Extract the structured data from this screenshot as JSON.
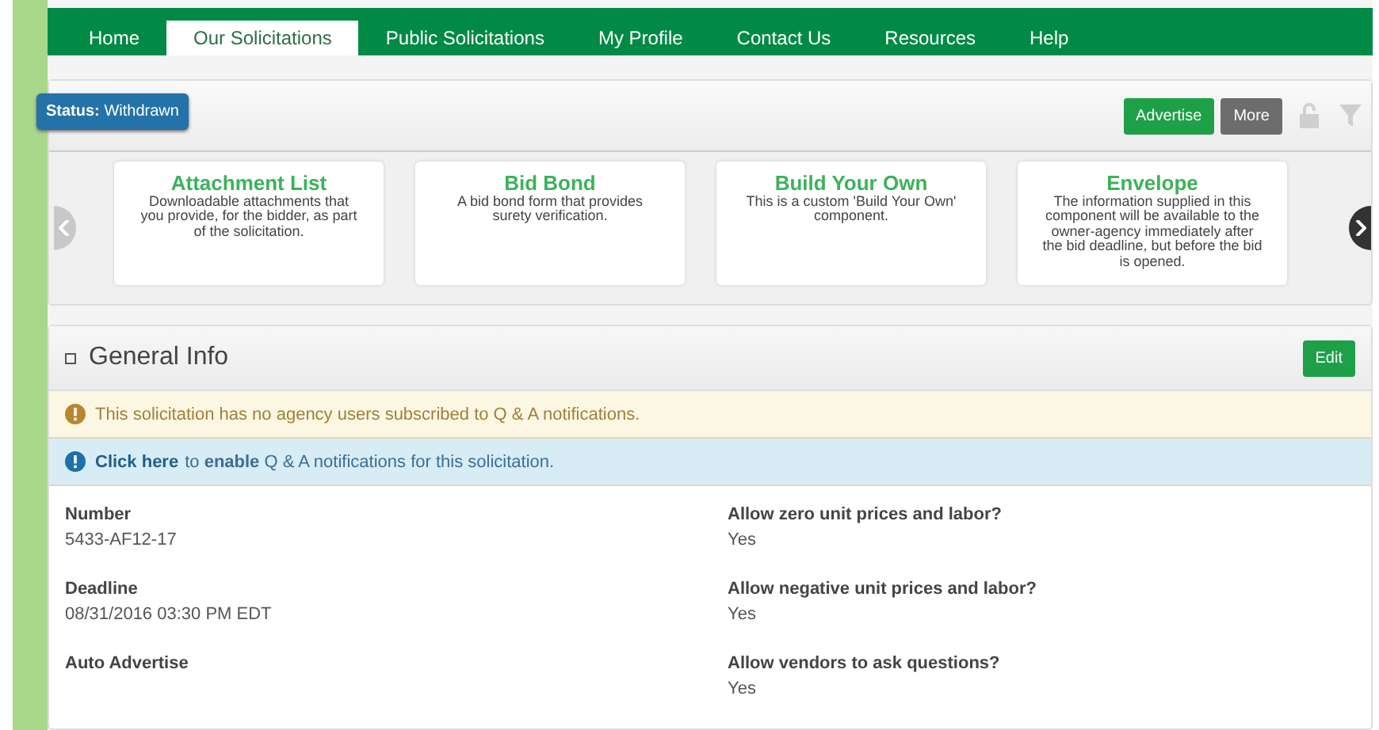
{
  "nav": {
    "tabs": [
      {
        "label": "Home",
        "selected": false
      },
      {
        "label": "Our Solicitations",
        "selected": true
      },
      {
        "label": "Public Solicitations",
        "selected": false
      },
      {
        "label": "My Profile",
        "selected": false
      },
      {
        "label": "Contact Us",
        "selected": false
      },
      {
        "label": "Resources",
        "selected": false
      },
      {
        "label": "Help",
        "selected": false
      }
    ]
  },
  "toolbar": {
    "status_label": "Status:",
    "status_value": "Withdrawn",
    "buttons": [
      {
        "label": "Advertise",
        "kind": "primary"
      },
      {
        "label": "More",
        "kind": "secondary"
      }
    ]
  },
  "components": [
    {
      "title": "Attachment List",
      "description": "Downloadable attachments that you provide, for the bidder, as part of the solicitation."
    },
    {
      "title": "Bid Bond",
      "description": "A bid bond form that provides surety verification."
    },
    {
      "title": "Build Your Own",
      "description": "This is a custom 'Build Your Own' component."
    },
    {
      "title": "Envelope",
      "description": "The information supplied in this component will be available to the owner-agency immediately after the bid deadline, but before the bid is opened."
    }
  ],
  "carousel": {
    "prev_disabled": true,
    "next_disabled": false
  },
  "general_info": {
    "title": "General Info",
    "edit_button": "Edit",
    "alerts": [
      {
        "kind": "warning",
        "text": "This solicitation has no agency users subscribed to Q & A notifications."
      },
      {
        "kind": "info",
        "link": "Click here",
        "text": "to **enable** Q & A notifications for this solicitation."
      }
    ],
    "left_fields": [
      {
        "label": "Number",
        "value": "5433-AF12-17"
      },
      {
        "label": "Deadline",
        "value": "08/31/2016 03:30 PM EDT"
      },
      {
        "label": "Auto Advertise"
      }
    ],
    "right_fields": [
      {
        "label": "Allow zero unit prices and labor?",
        "value": "Yes"
      },
      {
        "label": "Allow negative unit prices and labor?",
        "value": "Yes"
      },
      {
        "label": "Allow vendors to ask questions?",
        "value": "Yes"
      }
    ]
  }
}
